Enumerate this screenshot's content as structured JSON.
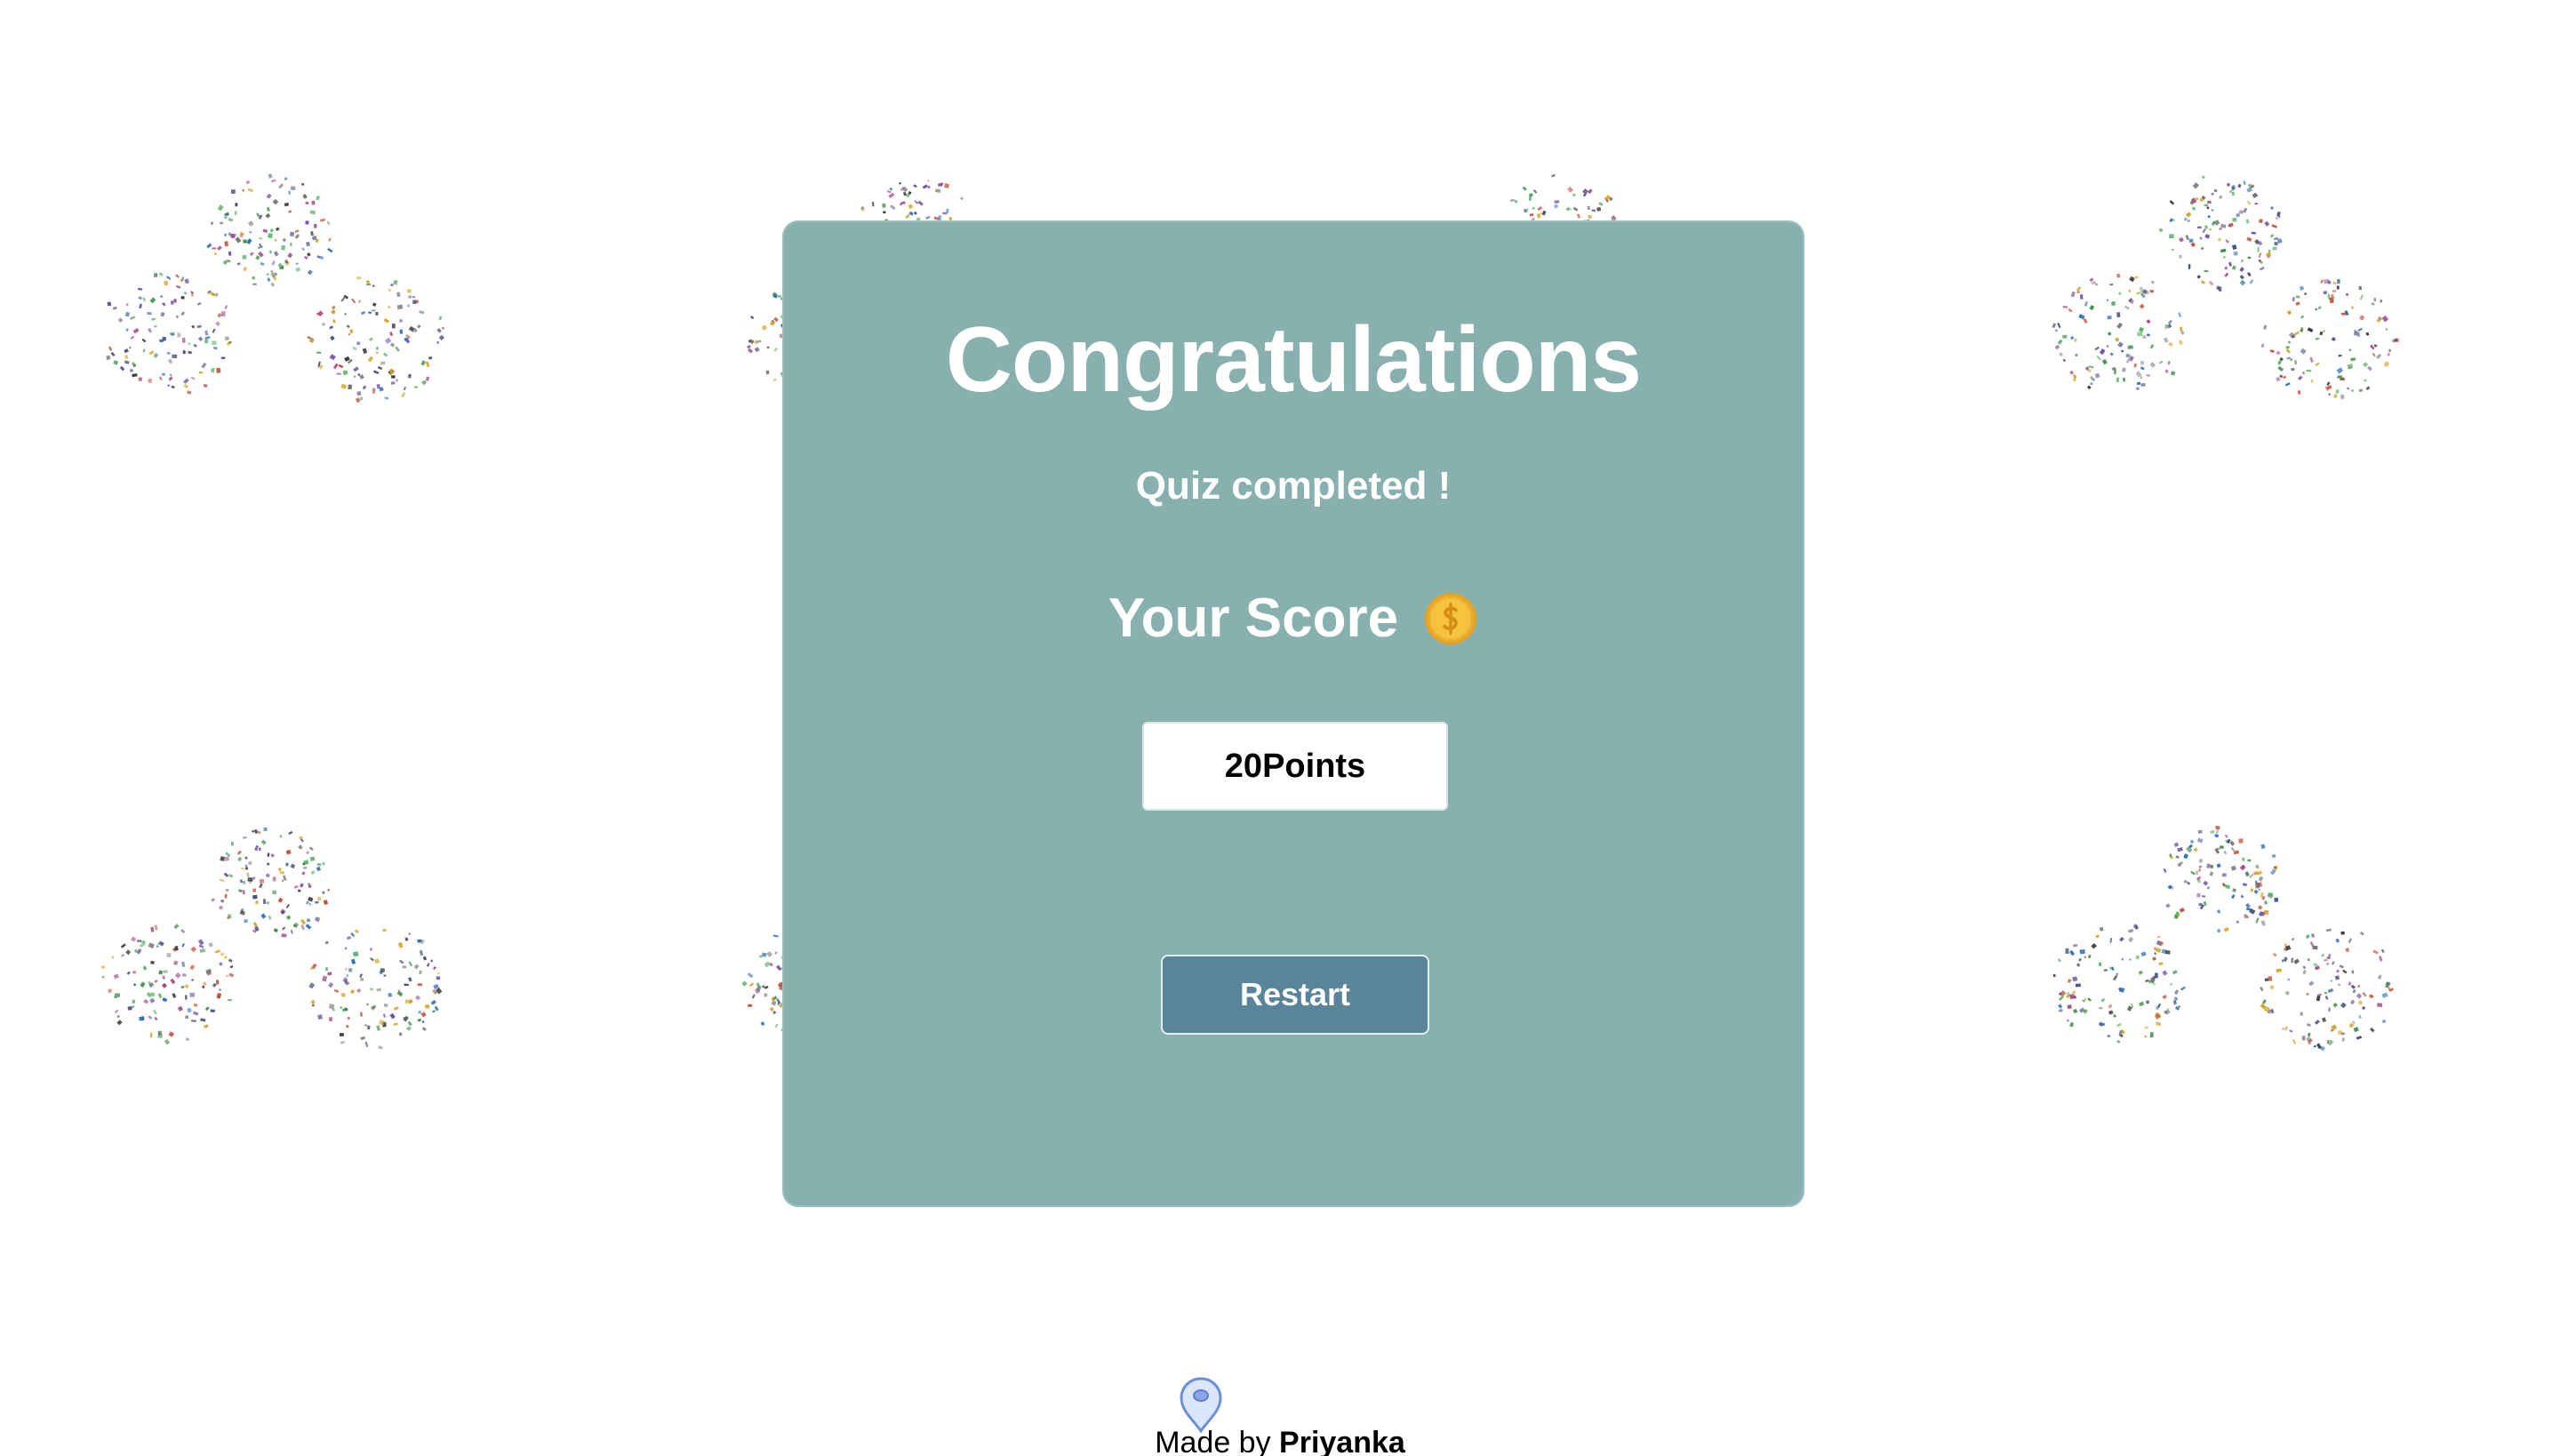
{
  "card": {
    "title": "Congratulations",
    "subtitle": "Quiz completed !",
    "score_label": "Your Score",
    "score_value": "20",
    "score_unit": "Points",
    "restart_label": "Restart"
  },
  "footer": {
    "prefix": "Made by ",
    "author": "Priyanka"
  },
  "icons": {
    "score": "coin-icon",
    "footer": "map-pin-icon"
  },
  "colors": {
    "card_background": "#87b0af",
    "restart_background": "#5a8499",
    "coin": "#f2b632"
  }
}
